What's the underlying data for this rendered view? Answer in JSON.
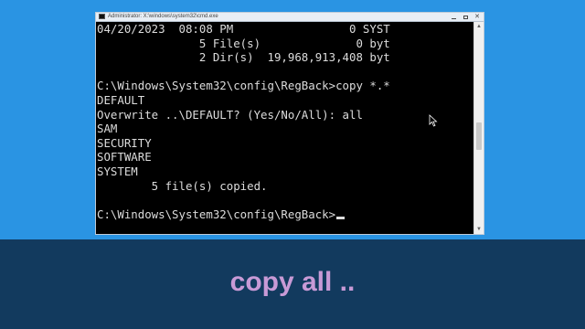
{
  "window": {
    "title": "Administrator: X:\\windows\\system32\\cmd.exe",
    "controls": {
      "minimize": "–",
      "maximize": "□",
      "close": "✕"
    }
  },
  "console": {
    "lines": [
      "04/20/2023  08:08 PM                 0 SYST",
      "               5 File(s)              0 byt",
      "               2 Dir(s)  19,968,913,408 byt",
      "",
      "C:\\Windows\\System32\\config\\RegBack>copy *.*",
      "DEFAULT",
      "Overwrite ..\\DEFAULT? (Yes/No/All): all",
      "SAM",
      "SECURITY",
      "SOFTWARE",
      "SYSTEM",
      "        5 file(s) copied.",
      "",
      "C:\\Windows\\System32\\config\\RegBack>"
    ]
  },
  "scrollbar": {
    "up_icon": "▲",
    "down_icon": "▼"
  },
  "caption": {
    "text": "copy all .."
  },
  "colors": {
    "desktop": "#2a94e3",
    "console_bg": "#000000",
    "console_text": "#dcdcdc",
    "caption_band": "#123a5e",
    "caption_text": "#c89ad6"
  }
}
